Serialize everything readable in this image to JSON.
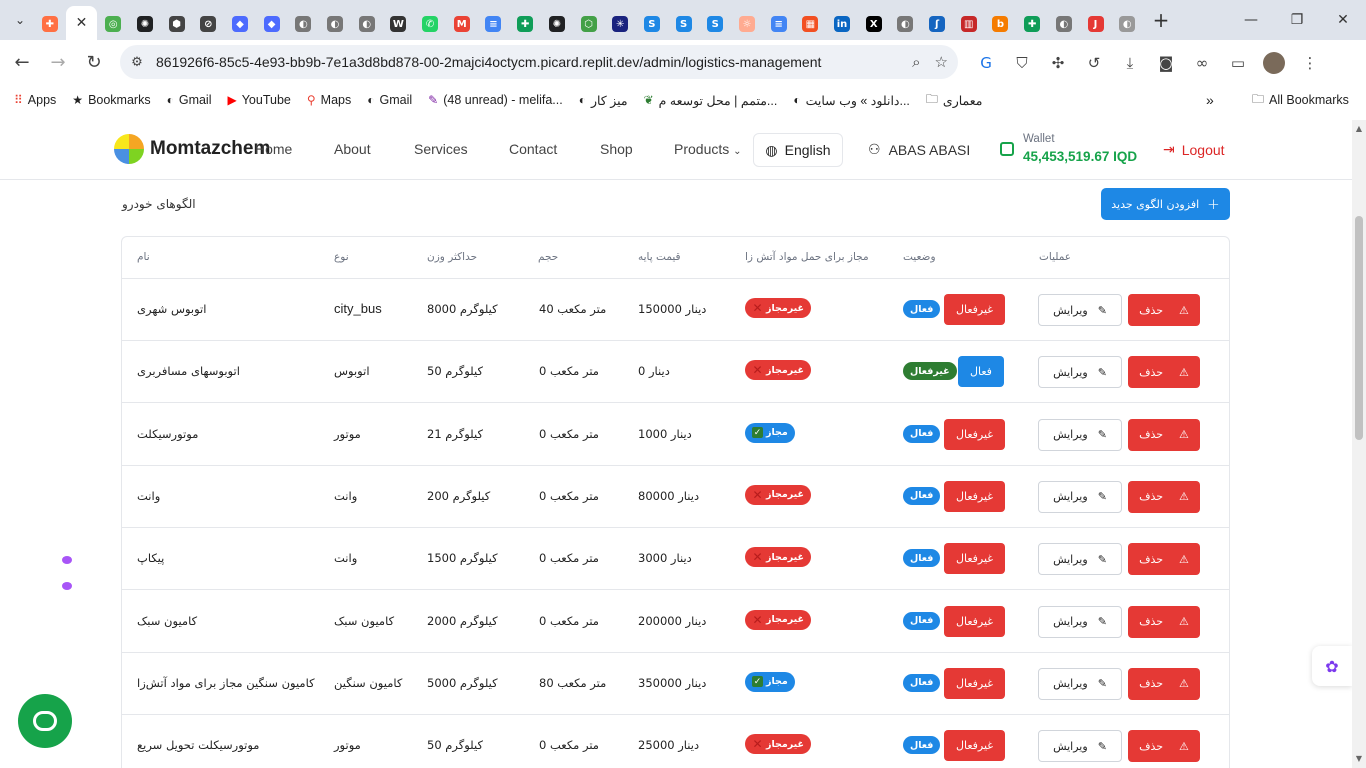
{
  "browser": {
    "tabs": [
      {
        "icon": "extension-icon",
        "color": "#ff7043",
        "glyph": "✚"
      },
      {
        "icon": "active-tab-icon",
        "color": "#ffffff",
        "glyph": "✕",
        "active": true
      },
      {
        "icon": "chrome-icon",
        "color": "#4caf50",
        "glyph": "◎"
      },
      {
        "icon": "openai-icon",
        "color": "#202123",
        "glyph": "✺"
      },
      {
        "icon": "github-icon",
        "color": "#444444",
        "glyph": "⬢"
      },
      {
        "icon": "circle-slash-icon",
        "color": "#444444",
        "glyph": "⊘"
      },
      {
        "icon": "deepseek-icon",
        "color": "#4d6bfe",
        "glyph": "◆"
      },
      {
        "icon": "deepseek-icon",
        "color": "#4d6bfe",
        "glyph": "◆"
      },
      {
        "icon": "globe-icon",
        "color": "#777777",
        "glyph": "◐"
      },
      {
        "icon": "globe-icon",
        "color": "#777777",
        "glyph": "◐"
      },
      {
        "icon": "globe-icon",
        "color": "#777777",
        "glyph": "◐"
      },
      {
        "icon": "wikipedia-icon",
        "color": "#333333",
        "glyph": "W"
      },
      {
        "icon": "whatsapp-icon",
        "color": "#25d366",
        "glyph": "✆"
      },
      {
        "icon": "gmail-icon",
        "color": "#ea4335",
        "glyph": "M"
      },
      {
        "icon": "docs-icon",
        "color": "#4285f4",
        "glyph": "≡"
      },
      {
        "icon": "sheets-icon",
        "color": "#0f9d58",
        "glyph": "✚"
      },
      {
        "icon": "openai-icon",
        "color": "#202123",
        "glyph": "✺"
      },
      {
        "icon": "shield-icon",
        "color": "#43a047",
        "glyph": "⬡"
      },
      {
        "icon": "perplexity-icon",
        "color": "#1a237e",
        "glyph": "✳"
      },
      {
        "icon": "s-app-icon",
        "color": "#1e88e5",
        "glyph": "S"
      },
      {
        "icon": "s-app-icon",
        "color": "#1e88e5",
        "glyph": "S"
      },
      {
        "icon": "s-app-icon",
        "color": "#1e88e5",
        "glyph": "S"
      },
      {
        "icon": "spinner-icon",
        "color": "#ffab91",
        "glyph": "☼"
      },
      {
        "icon": "docs-icon",
        "color": "#4285f4",
        "glyph": "≡"
      },
      {
        "icon": "microsoft-icon",
        "color": "#f25022",
        "glyph": "▦"
      },
      {
        "icon": "linkedin-icon",
        "color": "#0a66c2",
        "glyph": "in"
      },
      {
        "icon": "x-icon",
        "color": "#000000",
        "glyph": "X"
      },
      {
        "icon": "globe-icon",
        "color": "#777777",
        "glyph": "◐"
      },
      {
        "icon": "s-script-icon",
        "color": "#1565c0",
        "glyph": "ʃ"
      },
      {
        "icon": "building-icon",
        "color": "#c62828",
        "glyph": "▥"
      },
      {
        "icon": "b-icon",
        "color": "#f57c00",
        "glyph": "b"
      },
      {
        "icon": "sheets-icon",
        "color": "#0f9d58",
        "glyph": "✚"
      },
      {
        "icon": "globe-icon",
        "color": "#777777",
        "glyph": "◐"
      },
      {
        "icon": "jpg-png-icon",
        "color": "#e53935",
        "glyph": "J"
      },
      {
        "icon": "globe-icon",
        "color": "#999999",
        "glyph": "◐"
      }
    ],
    "url": "861926f6-85c5-4e93-bb9b-7e1a3d8bd878-00-2majci4octycm.picard.replit.dev/admin/logistics-management",
    "bookmarks": [
      {
        "icon": "apps-icon",
        "label": "Apps"
      },
      {
        "icon": "star-icon",
        "label": "Bookmarks"
      },
      {
        "icon": "globe-icon",
        "label": "Gmail"
      },
      {
        "icon": "youtube-icon",
        "label": "YouTube"
      },
      {
        "icon": "maps-icon",
        "label": "Maps"
      },
      {
        "icon": "globe-icon",
        "label": "Gmail"
      },
      {
        "icon": "feather-icon",
        "label": "(48 unread) - melifa..."
      },
      {
        "icon": "globe-icon",
        "label": "میز کار"
      },
      {
        "icon": "leaf-icon",
        "label": "متمم | محل توسعه م..."
      },
      {
        "icon": "globe-icon",
        "label": "دانلود » وب سایت..."
      },
      {
        "icon": "folder-icon",
        "label": "معماری"
      }
    ],
    "all_bookmarks": "All Bookmarks",
    "more_bookmarks": "»"
  },
  "header": {
    "brand": "Momtazchem",
    "nav": [
      "Home",
      "About",
      "Services",
      "Contact",
      "Shop",
      "Products"
    ],
    "language": "English",
    "user": "ABAS ABASI",
    "wallet_label": "Wallet",
    "wallet_value": "45,453,519.67 IQD",
    "logout": "Logout"
  },
  "section": {
    "title": "الگوهای خودرو",
    "add_button": "افزودن الگوی جدید"
  },
  "table": {
    "columns": {
      "name": "نام",
      "type": "نوع",
      "max_weight": "حداکثر وزن",
      "volume": "حجم",
      "base_price": "قیمت پایه",
      "hazmat": "مجاز برای حمل مواد آتش زا",
      "status": "وضعیت",
      "actions": "عملیات"
    },
    "rows": [
      {
        "name": "اتوبوس شهری",
        "type": "city_bus",
        "weight": "کیلوگرم 8000",
        "volume": "متر مکعب 40",
        "price": "دینار 150000",
        "hazmat": "غیرمجاز",
        "hazmat_ok": false,
        "status_badge": "فعال",
        "status_active": true,
        "toggle": "غیرفعال",
        "edit": "ویرایش",
        "delete": "حذف"
      },
      {
        "name": "اتوبوسهای مسافربری",
        "type": "اتوبوس",
        "weight": "کیلوگرم 50",
        "volume": "متر مکعب 0",
        "price": "دینار 0",
        "hazmat": "غیرمجاز",
        "hazmat_ok": false,
        "status_badge": "غیرفعال",
        "status_active": false,
        "toggle": "فعال",
        "edit": "ویرایش",
        "delete": "حذف"
      },
      {
        "name": "موتورسیکلت",
        "type": "موتور",
        "weight": "کیلوگرم 21",
        "volume": "متر مکعب 0",
        "price": "دینار 1000",
        "hazmat": "مجاز",
        "hazmat_ok": true,
        "status_badge": "فعال",
        "status_active": true,
        "toggle": "غیرفعال",
        "edit": "ویرایش",
        "delete": "حذف"
      },
      {
        "name": "وانت",
        "type": "وانت",
        "weight": "کیلوگرم 200",
        "volume": "متر مکعب 0",
        "price": "دینار 80000",
        "hazmat": "غیرمجاز",
        "hazmat_ok": false,
        "status_badge": "فعال",
        "status_active": true,
        "toggle": "غیرفعال",
        "edit": "ویرایش",
        "delete": "حذف"
      },
      {
        "name": "پیکاپ",
        "type": "وانت",
        "weight": "کیلوگرم 1500",
        "volume": "متر مکعب 0",
        "price": "دینار 3000",
        "hazmat": "غیرمجاز",
        "hazmat_ok": false,
        "status_badge": "فعال",
        "status_active": true,
        "toggle": "غیرفعال",
        "edit": "ویرایش",
        "delete": "حذف"
      },
      {
        "name": "کامیون سبک",
        "type": "کامیون سبک",
        "weight": "کیلوگرم 2000",
        "volume": "متر مکعب 0",
        "price": "دینار 200000",
        "hazmat": "غیرمجاز",
        "hazmat_ok": false,
        "status_badge": "فعال",
        "status_active": true,
        "toggle": "غیرفعال",
        "edit": "ویرایش",
        "delete": "حذف"
      },
      {
        "name": "کامیون سنگین مجاز برای مواد آتش‌زا",
        "type": "کامیون سنگین",
        "weight": "کیلوگرم 5000",
        "volume": "متر مکعب 80",
        "price": "دینار 350000",
        "hazmat": "مجاز",
        "hazmat_ok": true,
        "status_badge": "فعال",
        "status_active": true,
        "toggle": "غیرفعال",
        "edit": "ویرایش",
        "delete": "حذف"
      },
      {
        "name": "موتورسیکلت تحویل سریع",
        "type": "موتور",
        "weight": "کیلوگرم 50",
        "volume": "متر مکعب 0",
        "price": "دینار 25000",
        "hazmat": "غیرمجاز",
        "hazmat_ok": false,
        "status_badge": "فعال",
        "status_active": true,
        "toggle": "غیرفعال",
        "edit": "ویرایش",
        "delete": "حذف"
      }
    ]
  },
  "colors": {
    "primary": "#1e88e5",
    "danger": "#e53935",
    "success": "#16a34a",
    "inactive_badge": "#2e7d32"
  }
}
